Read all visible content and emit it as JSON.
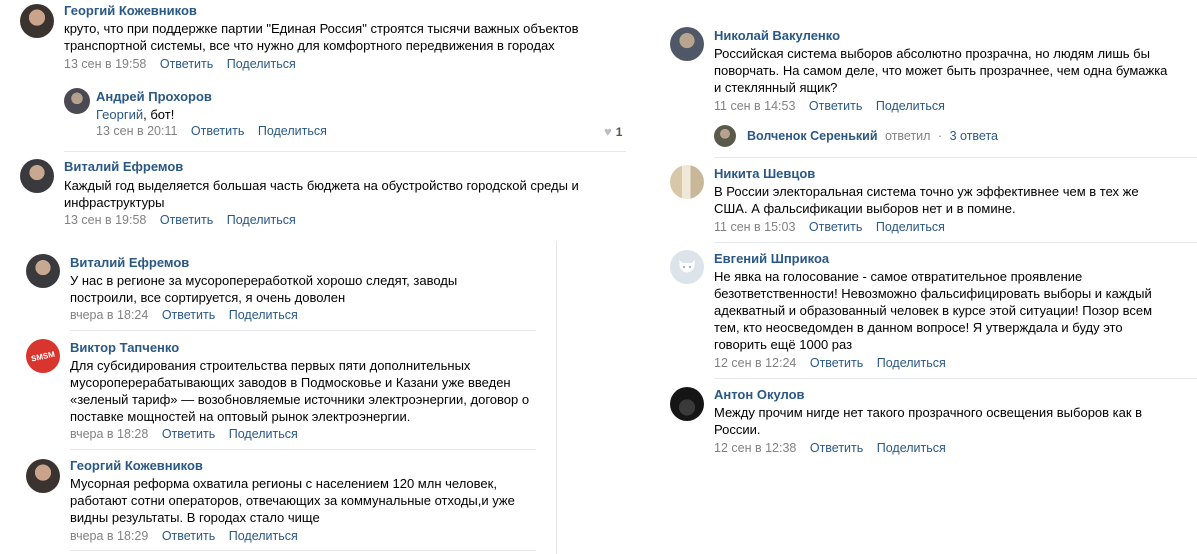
{
  "left_top": [
    {
      "name": "Георгий Кожевников",
      "lines": [
        "круто, что при поддержке партии \"Единая Россия\" строятся тысячи важных объектов",
        "транспортной системы, все что нужно для комфортного передвижения в городах"
      ],
      "date": "13 сен в 19:58"
    },
    {
      "name": "Андрей Прохоров",
      "reply_to": "Георгий",
      "text": ", бот!",
      "date": "13 сен в 20:11",
      "likes": "1"
    },
    {
      "name": "Виталий Ефремов",
      "lines": [
        "Каждый год выделяется большая часть бюджета на обустройство городской среды и",
        "инфраструктуры"
      ],
      "date": "13 сен в 19:58"
    }
  ],
  "left_bottom": [
    {
      "name": "Виталий Ефремов",
      "lines": [
        "У нас в регионе за мусоропереработкой хорошо следят, заводы",
        "построили, все сортируется, я очень доволен"
      ],
      "date": "вчера в 18:24"
    },
    {
      "name": "Виктор Тапченко",
      "lines": [
        "Для субсидирования строительства первых пяти дополнительных",
        "мусороперерабатывающих заводов в Подмосковье и Казани уже введен",
        "«зеленый тариф» — возобновляемые источники электроэнергии, договор о",
        "поставке мощностей на оптовый рынок электроэнергии."
      ],
      "date": "вчера в 18:28",
      "avatar_text": "SMSM"
    },
    {
      "name": "Георгий Кожевников",
      "lines": [
        "Мусорная реформа охватила регионы с населением 120 млн человек,",
        "работают сотни операторов, отвечающих за коммунальные отходы,и уже",
        "видны результаты. В городах стало чище"
      ],
      "date": "вчера в 18:29"
    }
  ],
  "right": [
    {
      "name": "Николай Вакуленко",
      "lines": [
        "Российская система выборов абсолютно прозрачна, но людям лишь бы",
        "поворчать. На самом деле, что может быть прозрачнее, чем одна бумажка",
        "и стеклянный ящик?"
      ],
      "date": "11 сен в 14:53"
    },
    {
      "name": "Никита Шевцов",
      "lines": [
        "В России электоральная система точно уж эффективнее чем в тех же",
        "США. А фальсификации выборов нет и в помине."
      ],
      "date": "11 сен в 15:03"
    },
    {
      "name": "Евгений Шприкоа",
      "lines": [
        "Не явка на голосование - самое отвратительное проявление",
        "безответственности! Невозможно фальсифицировать выборы и каждый",
        "адекватный и образованный человек в курсе этой ситуации! Позор всем",
        "тем, кто неосведомден в данном вопросе! Я утверждала и буду это",
        "говорить ещё 1000 раз"
      ],
      "date": "12 сен в 12:24"
    },
    {
      "name": "Антон Окулов",
      "lines": [
        "Между прочим нигде нет такого прозрачного освещения выборов как в",
        "России."
      ],
      "date": "12 сен в 12:38"
    }
  ],
  "thread": {
    "name": "Волченок Серенький",
    "action": "ответил",
    "dot": "·",
    "replies": "3 ответа"
  },
  "actions": {
    "reply": "Ответить",
    "share": "Поделиться"
  },
  "colors": {
    "link": "#2a5885",
    "meta": "#828282",
    "separator": "#e7e8ec"
  }
}
